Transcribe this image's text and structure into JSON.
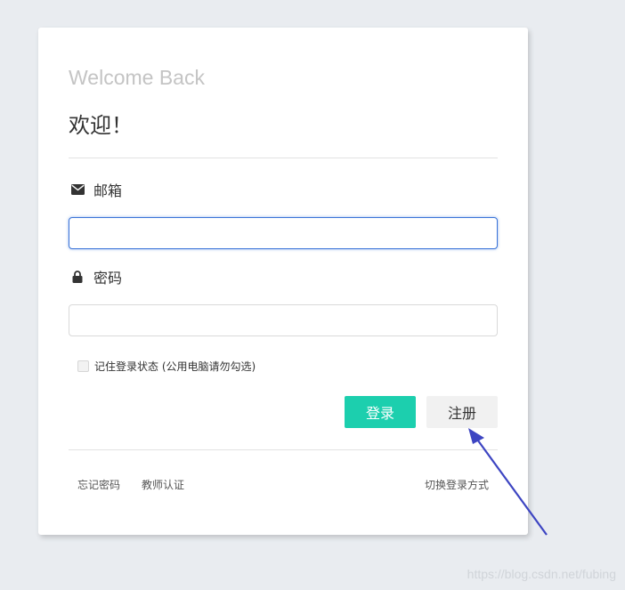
{
  "card": {
    "welcome": "Welcome Back",
    "title": "欢迎！"
  },
  "form": {
    "email_label": "邮箱",
    "email_value": "",
    "password_label": "密码",
    "password_value": "",
    "remember_label": "记住登录状态 (公用电脑请勿勾选)",
    "remember_checked": false
  },
  "buttons": {
    "login": "登录",
    "register": "注册"
  },
  "footer": {
    "forgot": "忘记密码",
    "teacher": "教师认证",
    "switch": "切换登录方式"
  },
  "icons": {
    "email": "envelope-icon",
    "password": "lock-icon"
  },
  "colors": {
    "primary": "#1ccfae",
    "focus": "#3b74d8",
    "annotation": "#3d45c2"
  },
  "watermark": "https://blog.csdn.net/fubing"
}
